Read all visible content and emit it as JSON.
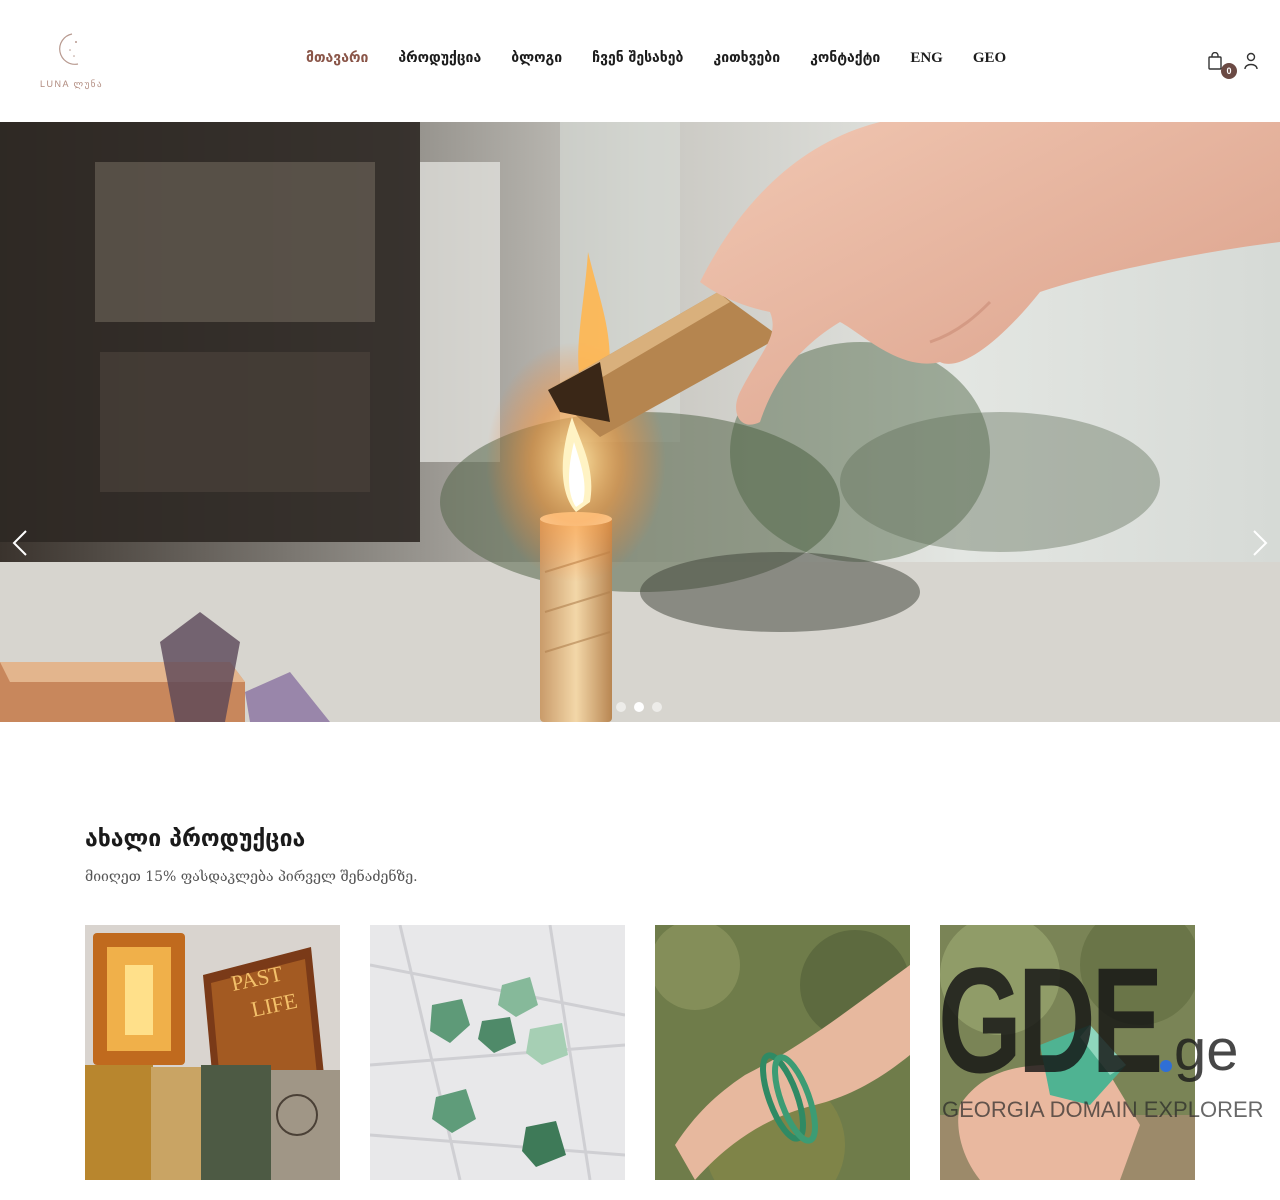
{
  "brand": {
    "logo_text": "LUNA ლუნა"
  },
  "nav": {
    "items": [
      {
        "label": "მთავარი",
        "active": true
      },
      {
        "label": "პროდუქცია",
        "active": false
      },
      {
        "label": "ბლოგი",
        "active": false
      },
      {
        "label": "ჩვენ შესახებ",
        "active": false
      },
      {
        "label": "კითხვები",
        "active": false
      },
      {
        "label": "კონტაქტი",
        "active": false
      },
      {
        "label": "ENG",
        "active": false
      },
      {
        "label": "GEO",
        "active": false
      }
    ]
  },
  "cart": {
    "count": "0",
    "icon": "shopping-bag-icon"
  },
  "account": {
    "icon": "user-icon"
  },
  "hero": {
    "slides": 3,
    "active_slide": 2,
    "prev_icon": "chevron-left-icon",
    "next_icon": "chevron-right-icon"
  },
  "section": {
    "title": "ახალი პროდუქცია",
    "subtitle": "მიიღეთ 15% ფასდაკლება პირველ შენაძენზე."
  },
  "products": [
    {
      "image": "tarot-cards-past-life-oracle"
    },
    {
      "image": "green-aventurine-stones"
    },
    {
      "image": "green-bead-bracelet"
    },
    {
      "image": "green-crystal-in-hand"
    }
  ],
  "watermark": {
    "big": "GDE",
    "tld": "ge",
    "subtitle": "GEORGIA DOMAIN EXPLORER"
  },
  "colors": {
    "accent": "#8a5548",
    "badge": "#6b4a44",
    "nav_text": "#1c1c1c",
    "watermark_dot": "#2f6fd6"
  }
}
